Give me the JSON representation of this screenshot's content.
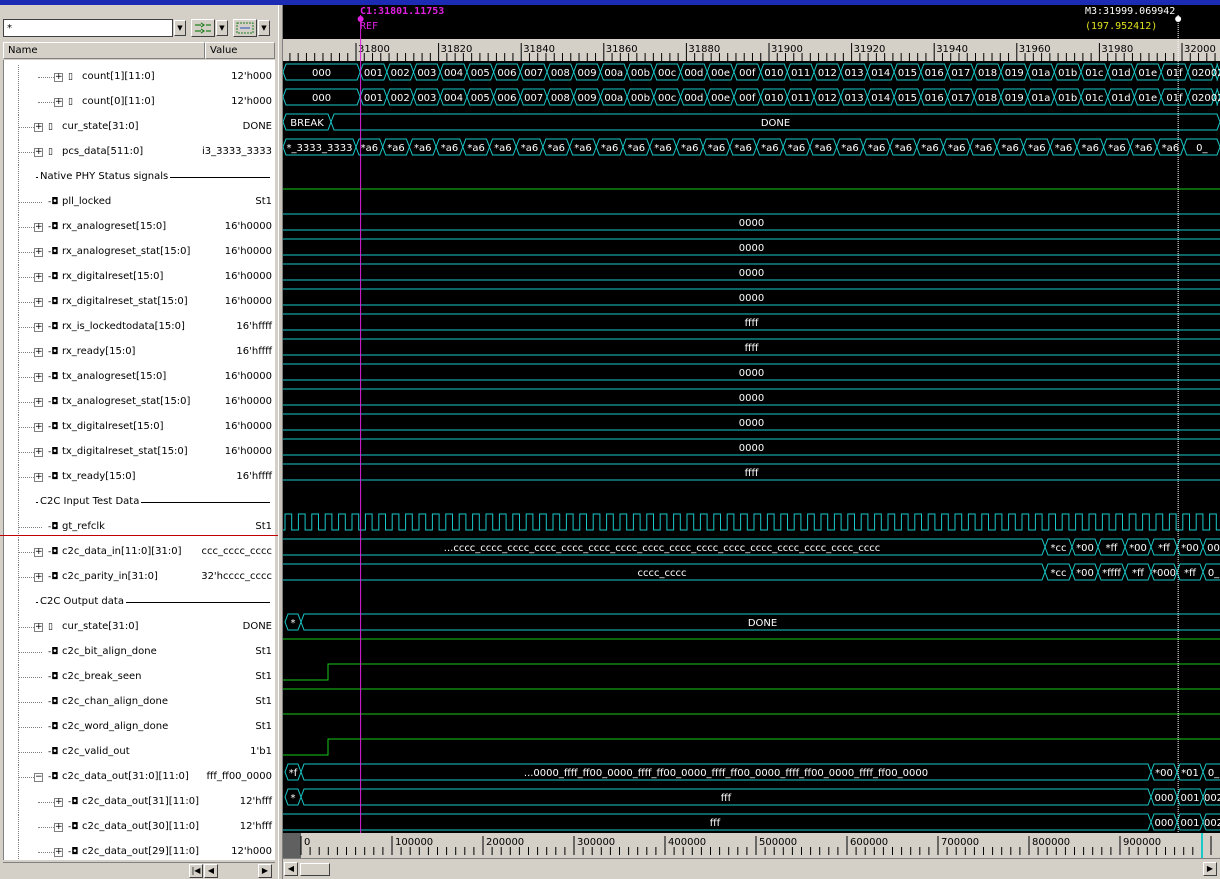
{
  "left_pane": {
    "filter_value": "*",
    "header": {
      "name": "Name",
      "value": "Value"
    },
    "rows": [
      {
        "kind": "sig",
        "indent": 2,
        "expander": "+",
        "icon": "bus",
        "name": "count[1][11:0]",
        "value": "12'h000"
      },
      {
        "kind": "sig",
        "indent": 2,
        "expander": "+",
        "icon": "bus",
        "name": "count[0][11:0]",
        "value": "12'h000"
      },
      {
        "kind": "sig",
        "indent": 1,
        "expander": "+",
        "icon": "bus",
        "name": "cur_state[31:0]",
        "value": "DONE"
      },
      {
        "kind": "sig",
        "indent": 1,
        "expander": "+",
        "icon": "bus",
        "name": "pcs_data[511:0]",
        "value": "i3_3333_3333"
      },
      {
        "kind": "div",
        "indent": 1,
        "name": "Native PHY Status signals"
      },
      {
        "kind": "sig",
        "indent": 1,
        "expander": "",
        "icon": "port",
        "name": "pll_locked",
        "value": "St1"
      },
      {
        "kind": "sig",
        "indent": 1,
        "expander": "+",
        "icon": "port",
        "name": "rx_analogreset[15:0]",
        "value": "16'h0000"
      },
      {
        "kind": "sig",
        "indent": 1,
        "expander": "+",
        "icon": "port",
        "name": "rx_analogreset_stat[15:0]",
        "value": "16'h0000"
      },
      {
        "kind": "sig",
        "indent": 1,
        "expander": "+",
        "icon": "port",
        "name": "rx_digitalreset[15:0]",
        "value": "16'h0000"
      },
      {
        "kind": "sig",
        "indent": 1,
        "expander": "+",
        "icon": "port",
        "name": "rx_digitalreset_stat[15:0]",
        "value": "16'h0000"
      },
      {
        "kind": "sig",
        "indent": 1,
        "expander": "+",
        "icon": "port",
        "name": "rx_is_lockedtodata[15:0]",
        "value": "16'hffff"
      },
      {
        "kind": "sig",
        "indent": 1,
        "expander": "+",
        "icon": "port",
        "name": "rx_ready[15:0]",
        "value": "16'hffff"
      },
      {
        "kind": "sig",
        "indent": 1,
        "expander": "+",
        "icon": "port",
        "name": "tx_analogreset[15:0]",
        "value": "16'h0000"
      },
      {
        "kind": "sig",
        "indent": 1,
        "expander": "+",
        "icon": "port",
        "name": "tx_analogreset_stat[15:0]",
        "value": "16'h0000"
      },
      {
        "kind": "sig",
        "indent": 1,
        "expander": "+",
        "icon": "port",
        "name": "tx_digitalreset[15:0]",
        "value": "16'h0000"
      },
      {
        "kind": "sig",
        "indent": 1,
        "expander": "+",
        "icon": "port",
        "name": "tx_digitalreset_stat[15:0]",
        "value": "16'h0000"
      },
      {
        "kind": "sig",
        "indent": 1,
        "expander": "+",
        "icon": "port",
        "name": "tx_ready[15:0]",
        "value": "16'hffff"
      },
      {
        "kind": "div",
        "indent": 1,
        "name": "C2C Input Test Data"
      },
      {
        "kind": "sig",
        "indent": 1,
        "expander": "",
        "icon": "port",
        "name": "gt_refclk",
        "value": "St1"
      },
      {
        "kind": "sig",
        "indent": 1,
        "expander": "+",
        "icon": "port",
        "name": "c2c_data_in[11:0][31:0]",
        "value": "ccc_cccc_cccc"
      },
      {
        "kind": "sig",
        "indent": 1,
        "expander": "+",
        "icon": "port",
        "name": "c2c_parity_in[31:0]",
        "value": "32'hcccc_cccc"
      },
      {
        "kind": "div",
        "indent": 1,
        "name": "C2C Output data"
      },
      {
        "kind": "sig",
        "indent": 1,
        "expander": "+",
        "icon": "bus",
        "name": "cur_state[31:0]",
        "value": "DONE"
      },
      {
        "kind": "sig",
        "indent": 1,
        "expander": "",
        "icon": "port",
        "name": "c2c_bit_align_done",
        "value": "St1"
      },
      {
        "kind": "sig",
        "indent": 1,
        "expander": "",
        "icon": "port",
        "name": "c2c_break_seen",
        "value": "St1"
      },
      {
        "kind": "sig",
        "indent": 1,
        "expander": "",
        "icon": "port",
        "name": "c2c_chan_align_done",
        "value": "St1"
      },
      {
        "kind": "sig",
        "indent": 1,
        "expander": "",
        "icon": "port",
        "name": "c2c_word_align_done",
        "value": "St1"
      },
      {
        "kind": "sig",
        "indent": 1,
        "expander": "",
        "icon": "port",
        "name": "c2c_valid_out",
        "value": "1'b1"
      },
      {
        "kind": "sig",
        "indent": 1,
        "expander": "-",
        "icon": "port",
        "name": "c2c_data_out[31:0][11:0]",
        "value": "fff_ff00_0000"
      },
      {
        "kind": "sig",
        "indent": 2,
        "expander": "+",
        "icon": "port",
        "name": "c2c_data_out[31][11:0]",
        "value": "12'hfff"
      },
      {
        "kind": "sig",
        "indent": 2,
        "expander": "+",
        "icon": "port",
        "name": "c2c_data_out[30][11:0]",
        "value": "12'hfff"
      },
      {
        "kind": "sig",
        "indent": 2,
        "expander": "+",
        "icon": "port",
        "name": "c2c_data_out[29][11:0]",
        "value": "12'h000"
      }
    ]
  },
  "cursors": {
    "c1_label": "C1:31801.11753",
    "c1_ref": "REF",
    "m3_label": "M3:31999.069942",
    "m3_delta": "(197.952412)"
  },
  "ruler": {
    "labels": [
      "31800",
      "31820",
      "31840",
      "31860",
      "31880",
      "31900",
      "31920",
      "31940",
      "31960",
      "31980",
      "32000"
    ]
  },
  "bottom_ruler": {
    "labels": [
      "0",
      "100000",
      "200000",
      "300000",
      "400000",
      "500000",
      "600000",
      "700000",
      "800000",
      "900000"
    ]
  },
  "waves": {
    "count_pre": "000",
    "count_seq": [
      "001",
      "002",
      "003",
      "004",
      "005",
      "006",
      "007",
      "008",
      "009",
      "00a",
      "00b",
      "00c",
      "00d",
      "00e",
      "00f",
      "010",
      "011",
      "012",
      "013",
      "014",
      "015",
      "016",
      "017",
      "018",
      "019",
      "01a",
      "01b",
      "01c",
      "01d",
      "01e",
      "01f",
      "020",
      "02"
    ],
    "cur_state_pre": "BREAK",
    "cur_state_main": "DONE",
    "pcs_pre": "*_3333_3333",
    "pcs_item": "*a6",
    "pcs_tail": "0_",
    "bus_values": [
      "0000",
      "0000",
      "0000",
      "0000",
      "ffff",
      "ffff",
      "0000",
      "0000",
      "0000",
      "0000",
      "ffff"
    ],
    "data_in_main": "...cccc_cccc_cccc_cccc_cccc_cccc_cccc_cccc_cccc_cccc_cccc_cccc_cccc_cccc_cccc_cccc",
    "data_in_tail": [
      "*cc",
      "*00",
      "*ff",
      "*00",
      "*ff",
      "*00",
      "00"
    ],
    "parity_main": "cccc_cccc",
    "parity_tail": [
      "*cc",
      "*00",
      "*ffff",
      "*ff",
      "*000",
      "*ff",
      "0_"
    ],
    "out_state_pre": "*",
    "out_state_main": "DONE",
    "data_out_pre": "*f",
    "data_out_main": "...0000_ffff_ff00_0000_ffff_ff00_0000_ffff_ff00_0000_ffff_ff00_0000_ffff_ff00_0000",
    "data_out_tail": [
      "*00",
      "*01",
      "0_"
    ],
    "data_out31_pre": "*",
    "data_out31_main": "fff",
    "data_out30_main": "fff",
    "data_out_sub_tail": [
      "000",
      "001",
      "002"
    ]
  },
  "colors": {
    "wave_bus": "#19c8c8",
    "wave_bit": "#19c819",
    "cursor_c1": "#e020e0",
    "cursor_m3": "#ffffff",
    "m3_delta": "#e0e020"
  }
}
